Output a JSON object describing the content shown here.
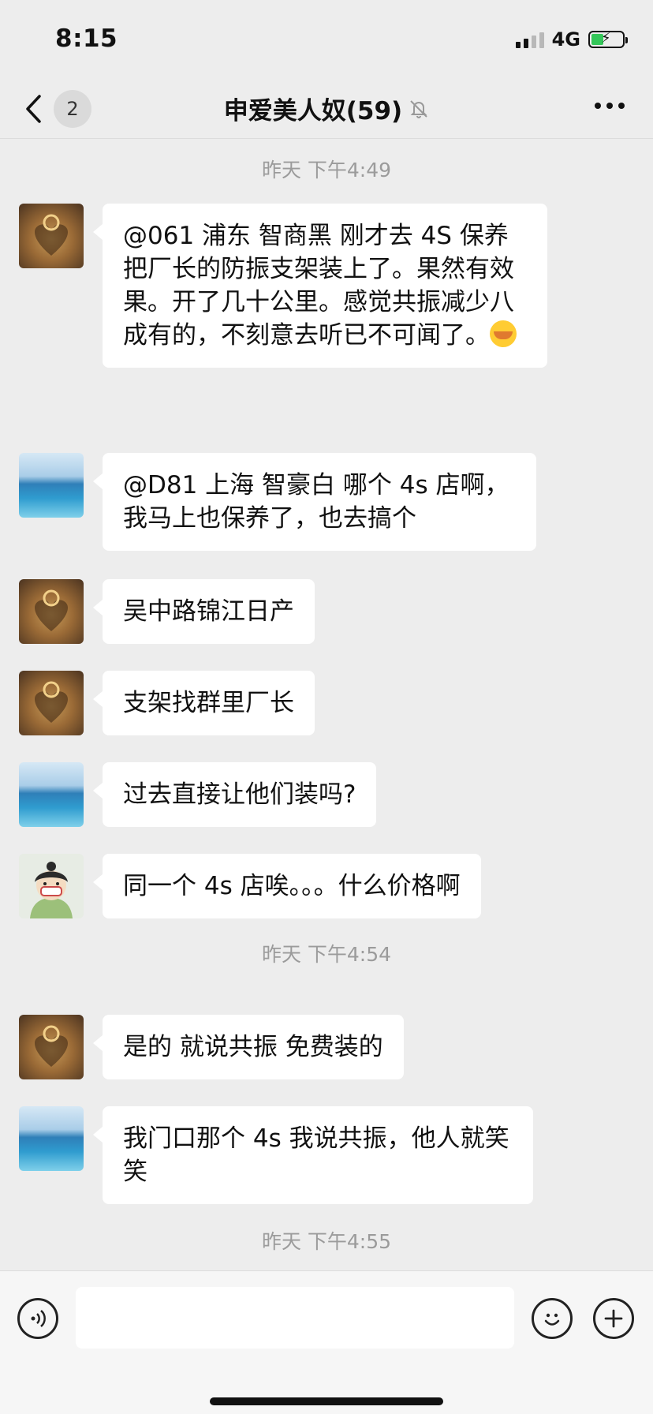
{
  "status": {
    "time": "8:15",
    "network": "4G"
  },
  "nav": {
    "back_badge": "2",
    "title": "申爱美人奴(59)"
  },
  "chat": {
    "timestamps": [
      "昨天 下午4:49",
      "昨天 下午4:54",
      "昨天 下午4:55"
    ],
    "messages": [
      {
        "avatar": "ring-avatar",
        "text_prefix": "@061 浦东 智商黑  刚才去 4S 保养把厂长的防振支架装上了。果然有效果。开了几十公里。感觉共振减少八成有的，不刻意去听已不可闻了。"
      },
      {
        "avatar": "sea-avatar",
        "text": "@D81 上海 智豪白  哪个 4s 店啊，我马上也保养了，也去搞个"
      },
      {
        "avatar": "ring-avatar",
        "text": "吴中路锦江日产"
      },
      {
        "avatar": "ring-avatar",
        "text": "支架找群里厂长"
      },
      {
        "avatar": "sea-avatar",
        "text": "过去直接让他们装吗?"
      },
      {
        "avatar": "cartoon-avatar",
        "text": "同一个 4s 店唉。。。什么价格啊"
      },
      {
        "avatar": "ring-avatar",
        "text": "是的 就说共振 免费装的"
      },
      {
        "avatar": "sea-avatar",
        "text": "我门口那个 4s 我说共振，他人就笑笑"
      }
    ]
  },
  "input": {
    "placeholder": ""
  },
  "icons": {
    "back": "chevron-left-icon",
    "mute": "bell-off-icon",
    "more": "more-icon",
    "voice": "voice-icon",
    "emoji": "emoji-icon",
    "plus": "plus-icon"
  }
}
